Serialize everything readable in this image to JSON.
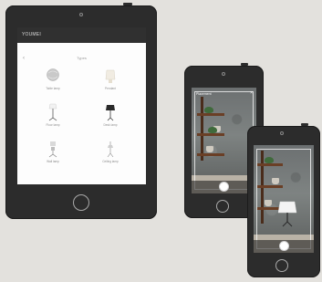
{
  "tablet": {
    "app_title": "YOUMEI",
    "back_icon": "chevron-left-icon",
    "page_title": "Types",
    "lamps": [
      {
        "label": "Table lamp",
        "icon": "globe-lamp-icon"
      },
      {
        "label": "Pendant",
        "icon": "pendant-lamp-icon"
      },
      {
        "label": "Floor lamp",
        "icon": "floor-lamp-icon"
      },
      {
        "label": "Desk lamp",
        "icon": "desk-lamp-icon"
      },
      {
        "label": "Wall lamp",
        "icon": "wall-lamp-icon"
      },
      {
        "label": "Ceiling lamp",
        "icon": "ceiling-lamp-icon"
      }
    ]
  },
  "phone_a": {
    "screen_label": "Placement",
    "close_icon": "close-icon",
    "shutter_icon": "shutter-button-icon"
  },
  "phone_b": {
    "placed_item_icon": "lamp-placed-icon",
    "shutter_icon": "shutter-button-icon"
  },
  "colors": {
    "background": "#e3e1dd",
    "device_body": "#2c2c2c",
    "topbar": "#303030",
    "shelf_wood": "#6a3f26"
  }
}
